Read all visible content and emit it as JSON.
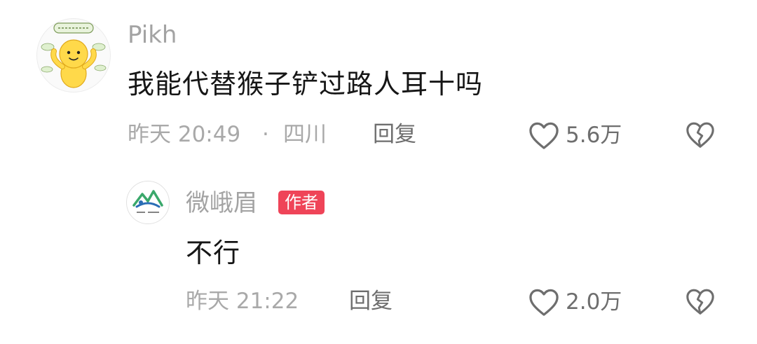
{
  "comment": {
    "username": "Pikh",
    "avatar_icon": "yellow-cartoon-avatar-icon",
    "text": "我能代替猴子铲过路人耳十吗",
    "timestamp": "昨天 20:49",
    "separator": "·",
    "location": "四川",
    "reply_label": "回复",
    "like_count": "5.6万",
    "icons": {
      "like": "heart-outline-icon",
      "dislike": "broken-heart-icon"
    }
  },
  "reply": {
    "username": "微峨眉",
    "avatar_icon": "mountain-logo-avatar-icon",
    "badge": "作者",
    "text": "不行",
    "timestamp": "昨天 21:22",
    "reply_label": "回复",
    "like_count": "2.0万",
    "icons": {
      "like": "heart-outline-icon",
      "dislike": "broken-heart-icon"
    }
  },
  "colors": {
    "badge_bg": "#ef4458",
    "text_primary": "#161616",
    "text_secondary": "#a9a9a9",
    "text_action": "#6e6e6e"
  }
}
